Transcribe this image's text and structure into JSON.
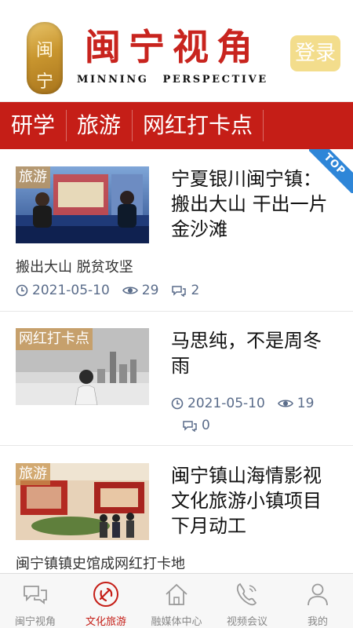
{
  "header": {
    "logo_chars": [
      "闽",
      "宁"
    ],
    "title_cn": "闽宁视角",
    "title_en_1": "MINNING",
    "title_en_2": "PERSPECTIVE",
    "login_label": "登录"
  },
  "categories": [
    "研学",
    "旅游",
    "网红打卡点"
  ],
  "articles": [
    {
      "tag": "旅游",
      "title": "宁夏银川闽宁镇：搬出大山 干出一片金沙滩",
      "summary": "搬出大山 脱贫攻坚",
      "date": "2021-05-10",
      "views": "29",
      "comments": "2",
      "top_badge": "TOP"
    },
    {
      "tag": "网红打卡点",
      "title": "马思纯，不是周冬雨",
      "summary": "",
      "date": "2021-05-10",
      "views": "19",
      "comments": "0"
    },
    {
      "tag": "旅游",
      "title": "闽宁镇山海情影视文化旅游小镇项目下月动工",
      "summary": "闽宁镇镇史馆成网红打卡地"
    }
  ],
  "bottom_nav": [
    {
      "label": "闽宁视角",
      "icon": "chat-bubbles-icon"
    },
    {
      "label": "文化旅游",
      "icon": "party-emblem-icon",
      "active": true
    },
    {
      "label": "融媒体中心",
      "icon": "home-icon"
    },
    {
      "label": "视频会议",
      "icon": "phone-icon"
    },
    {
      "label": "我的",
      "icon": "user-icon"
    }
  ],
  "colors": {
    "brand_red": "#c51e17",
    "login_bg": "#f3dd8c",
    "meta_blue": "#5a6c8a",
    "top_badge": "#2e86d8"
  }
}
